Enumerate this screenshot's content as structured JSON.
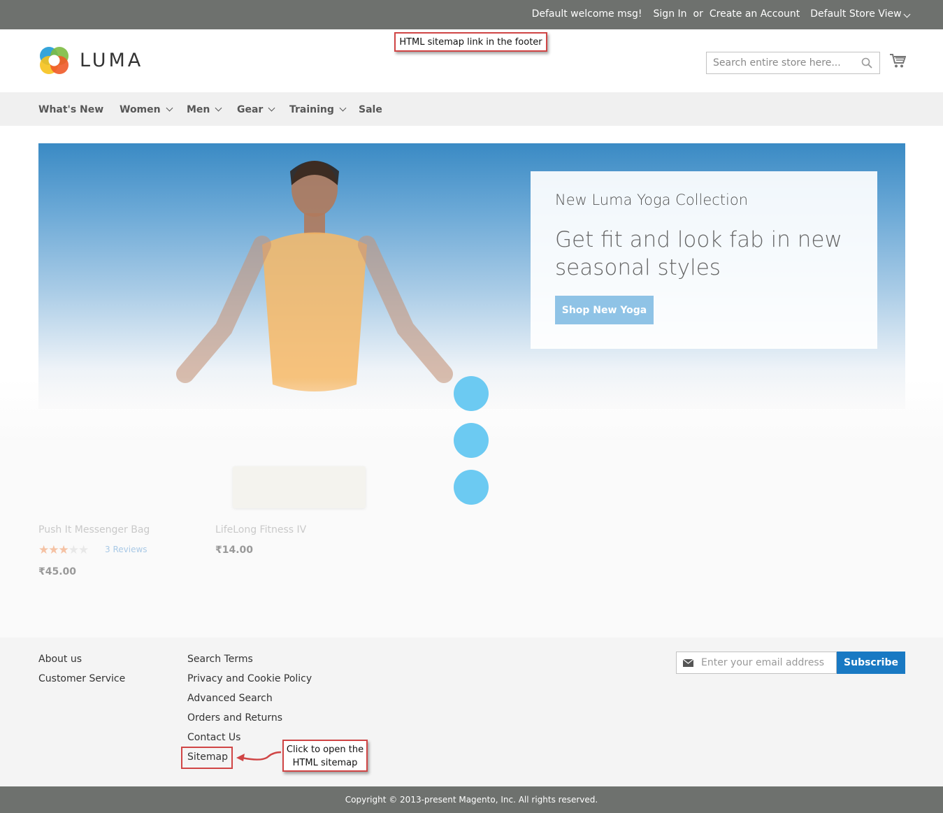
{
  "topbar": {
    "welcome": "Default welcome msg!",
    "sign_in": "Sign In",
    "or": "or",
    "create_account": "Create an Account",
    "store_view": "Default Store View"
  },
  "header": {
    "logo_text": "LUMA",
    "search_placeholder": "Search entire store here..."
  },
  "annotations": {
    "top_callout": "HTML sitemap link in the footer",
    "bottom_callout_line1": "Click to open the",
    "bottom_callout_line2": "HTML sitemap"
  },
  "nav": {
    "items": [
      {
        "label": "What's New",
        "has_dropdown": false
      },
      {
        "label": "Women",
        "has_dropdown": true
      },
      {
        "label": "Men",
        "has_dropdown": true
      },
      {
        "label": "Gear",
        "has_dropdown": true
      },
      {
        "label": "Training",
        "has_dropdown": true
      },
      {
        "label": "Sale",
        "has_dropdown": false
      }
    ]
  },
  "hero": {
    "subtitle": "New Luma Yoga Collection",
    "title": "Get fit and look fab in new seasonal styles",
    "button": "Shop New Yoga"
  },
  "products": [
    {
      "name": "Push It Messenger Bag",
      "price": "₹45.00",
      "rating": 3,
      "max_rating": 5,
      "reviews": "3 Reviews"
    },
    {
      "name": "LifeLong Fitness IV",
      "price": "₹14.00"
    }
  ],
  "footer": {
    "col1": [
      "About us",
      "Customer Service"
    ],
    "col2": [
      "Search Terms",
      "Privacy and Cookie Policy",
      "Advanced Search",
      "Orders and Returns",
      "Contact Us",
      "Sitemap"
    ],
    "newsletter_placeholder": "Enter your email address",
    "subscribe": "Subscribe",
    "copyright": "Copyright © 2013-present Magento, Inc. All rights reserved."
  },
  "colors": {
    "topbar_bg": "#6e716e",
    "nav_bg": "#f0f0f0",
    "subscribe_bg": "#1979c3",
    "hero_button_bg": "#8fc3e6",
    "annotation_red": "#d04545",
    "loader_dot": "#6ccaf2"
  }
}
